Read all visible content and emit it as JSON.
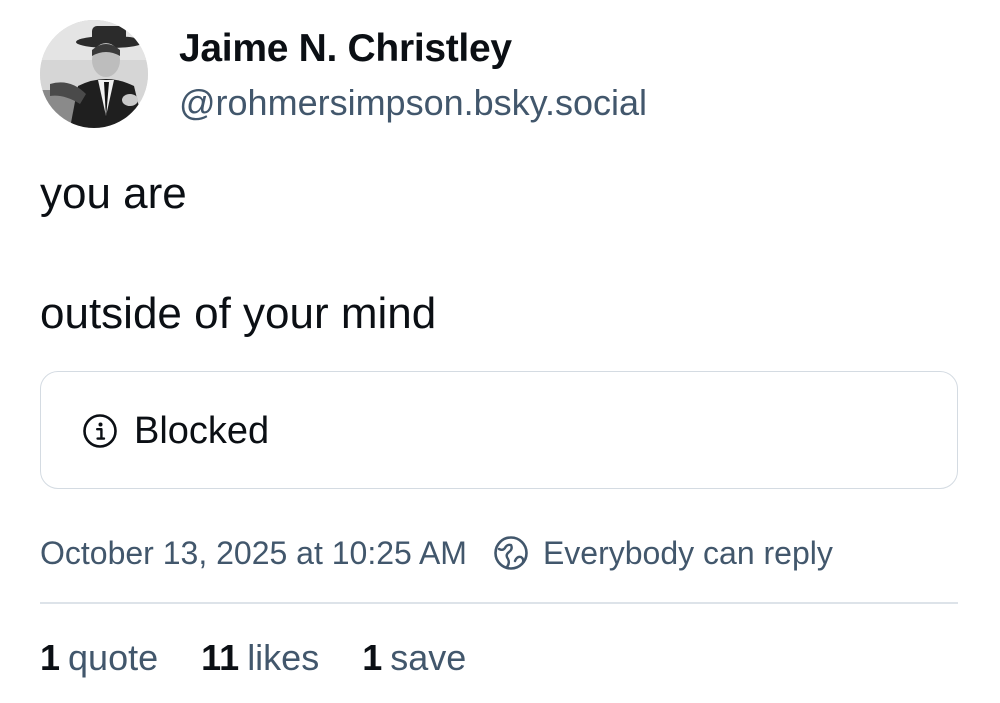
{
  "author": {
    "display_name": "Jaime N. Christley",
    "handle": "@rohmersimpson.bsky.social",
    "avatar_icon": "avatar-photo"
  },
  "post": {
    "lines": [
      "you are",
      "outside of your mind"
    ]
  },
  "embed": {
    "icon": "info-circle-icon",
    "label": "Blocked"
  },
  "meta": {
    "timestamp": "October 13, 2025 at 10:25 AM",
    "reply_setting_icon": "globe-icon",
    "reply_setting": "Everybody can reply"
  },
  "stats": {
    "quotes": {
      "count": "1",
      "label": "quote"
    },
    "likes": {
      "count": "11",
      "label": "likes"
    },
    "saves": {
      "count": "1",
      "label": "save"
    }
  },
  "colors": {
    "text_primary": "#0b0f14",
    "text_secondary": "#42576c",
    "border": "#d4dbe2"
  }
}
